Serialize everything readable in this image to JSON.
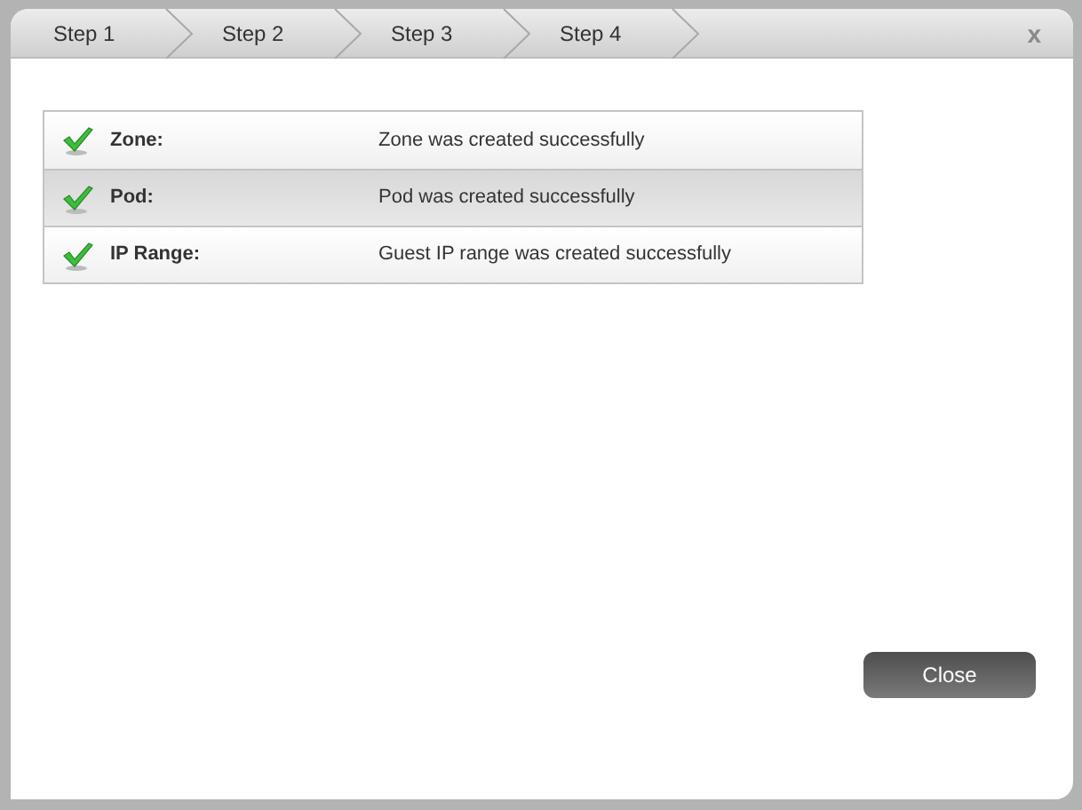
{
  "steps": [
    {
      "label": "Step 1"
    },
    {
      "label": "Step 2"
    },
    {
      "label": "Step 3"
    },
    {
      "label": "Step 4"
    }
  ],
  "close_icon": "x",
  "results": [
    {
      "label": "Zone:",
      "message": "Zone was created successfully"
    },
    {
      "label": "Pod:",
      "message": "Pod was created successfully"
    },
    {
      "label": "IP Range:",
      "message": "Guest IP range was created successfully"
    }
  ],
  "close_button": "Close"
}
